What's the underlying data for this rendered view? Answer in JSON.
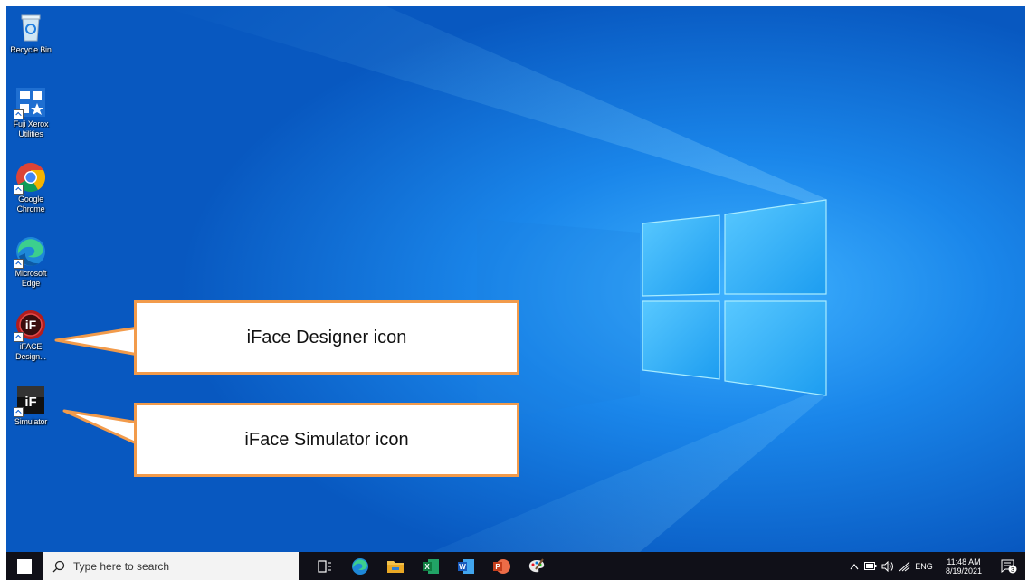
{
  "desktop": {
    "icons": [
      {
        "name": "recycle-bin",
        "label": "Recycle Bin"
      },
      {
        "name": "fuji-xerox-utilities",
        "label": "Fuji Xerox Utilities"
      },
      {
        "name": "google-chrome",
        "label": "Google Chrome"
      },
      {
        "name": "microsoft-edge",
        "label": "Microsoft Edge"
      },
      {
        "name": "iface-designer",
        "label": "iFACE Design...",
        "glyph_text": "iF"
      },
      {
        "name": "iface-simulator",
        "label": "Simulator",
        "glyph_text": "iF"
      }
    ]
  },
  "callouts": {
    "designer": "iFace Designer icon",
    "simulator": "iFace Simulator icon"
  },
  "taskbar": {
    "search_placeholder": "Type here to search",
    "apps": [
      "task-view-icon",
      "edge-icon",
      "file-explorer-icon",
      "excel-icon",
      "word-icon",
      "powerpoint-icon",
      "paint-icon"
    ],
    "excel_letter": "X",
    "word_letter": "W",
    "powerpoint_letter": "P",
    "tray": {
      "language": "ENG",
      "time": "11:48 AM",
      "date": "8/19/2021",
      "notification_count": "3"
    }
  },
  "colors": {
    "desktop_blue": "#0b63c9",
    "callout_border": "#f29b4b",
    "taskbar": "#101018"
  }
}
